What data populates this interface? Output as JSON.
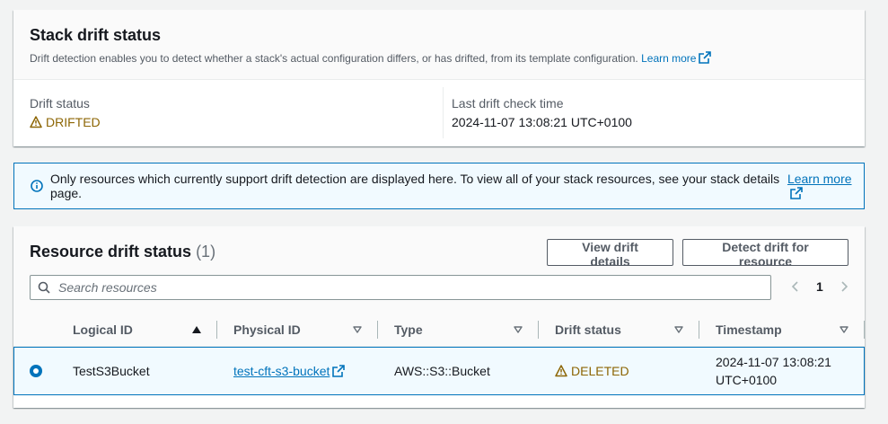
{
  "drift_panel": {
    "title": "Stack drift status",
    "description": "Drift detection enables you to detect whether a stack's actual configuration differs, or has drifted, from its template configuration.",
    "learn_more": "Learn more",
    "drift_status_label": "Drift status",
    "drift_status_value": "DRIFTED",
    "last_check_label": "Last drift check time",
    "last_check_value": "2024-11-07 13:08:21 UTC+0100"
  },
  "info_alert": {
    "text": "Only resources which currently support drift detection are displayed here. To view all of your stack resources, see your stack details page.",
    "learn_more": "Learn more"
  },
  "resource_panel": {
    "title": "Resource drift status",
    "count": "(1)",
    "view_button": "View drift details",
    "detect_button": "Detect drift for resource",
    "search_placeholder": "Search resources",
    "page_number": "1",
    "columns": [
      "Logical ID",
      "Physical ID",
      "Type",
      "Drift status",
      "Timestamp"
    ],
    "rows": [
      {
        "logical_id": "TestS3Bucket",
        "physical_id": "test-cft-s3-bucket",
        "type": "AWS::S3::Bucket",
        "drift_status": "DELETED",
        "timestamp_line1": "2024-11-07 13:08:21",
        "timestamp_line2": "UTC+0100"
      }
    ]
  },
  "colors": {
    "link": "#0073bb",
    "warning": "#8d6605",
    "selected_row_bg": "#f1faff"
  }
}
